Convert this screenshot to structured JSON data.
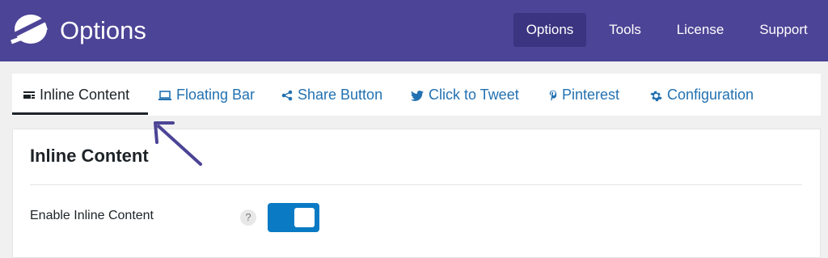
{
  "header": {
    "title": "Options",
    "nav": [
      {
        "label": "Options",
        "active": true
      },
      {
        "label": "Tools"
      },
      {
        "label": "License"
      },
      {
        "label": "Support"
      }
    ]
  },
  "tabs": [
    {
      "label": "Inline Content",
      "icon": "inline-content-icon",
      "active": true
    },
    {
      "label": "Floating Bar",
      "icon": "laptop-icon"
    },
    {
      "label": "Share Button",
      "icon": "share-icon"
    },
    {
      "label": "Click to Tweet",
      "icon": "twitter-icon"
    },
    {
      "label": "Pinterest",
      "icon": "pinterest-icon"
    },
    {
      "label": "Configuration",
      "icon": "gear-icon"
    }
  ],
  "panel": {
    "title": "Inline Content",
    "setting": {
      "label": "Enable Inline Content",
      "help": "?",
      "enabled": true
    }
  },
  "colors": {
    "header_bg": "#4c4496",
    "accent": "#2271b1",
    "toggle_on": "#0a7ac4",
    "annotation_arrow": "#4c4496"
  }
}
